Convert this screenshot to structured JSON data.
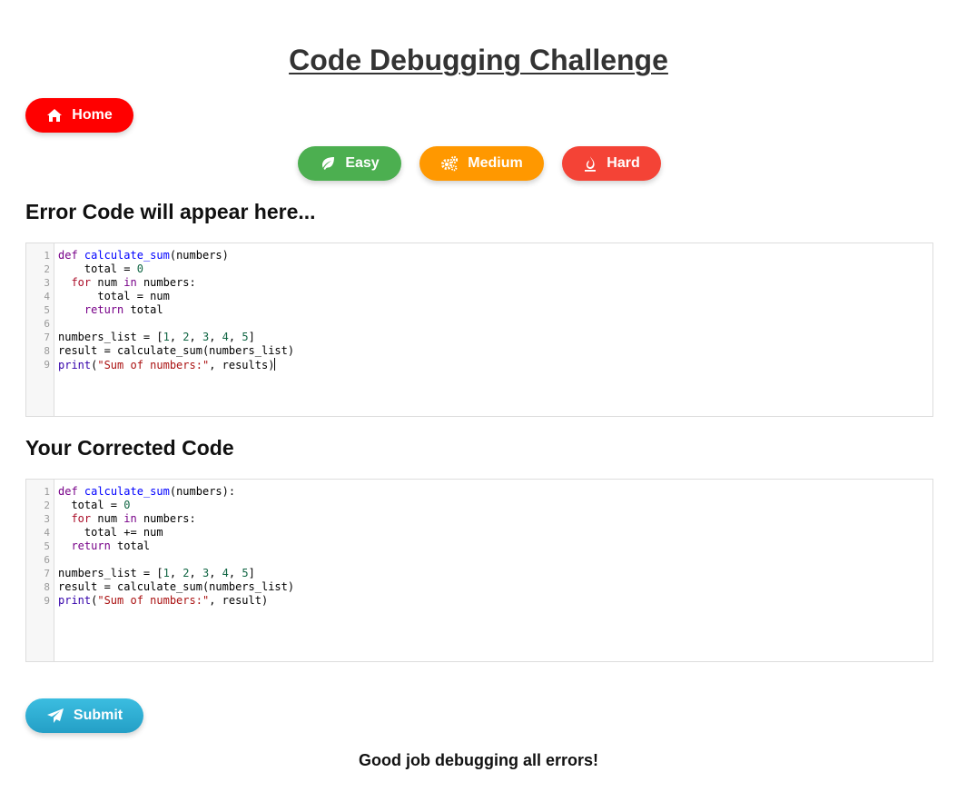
{
  "page": {
    "title": "Code Debugging Challenge"
  },
  "nav": {
    "home_label": "Home"
  },
  "difficulty": {
    "easy_label": "Easy",
    "medium_label": "Medium",
    "hard_label": "Hard"
  },
  "error_section": {
    "heading": "Error Code will appear here...",
    "line_numbers": [
      "1",
      "2",
      "3",
      "4",
      "5",
      "6",
      "7",
      "8",
      "9"
    ],
    "lines": [
      "def calculate_sum(numbers)",
      "    total = 0",
      "  for num in numbers:",
      "      total = num",
      "    return total",
      "",
      "numbers_list = [1, 2, 3, 4, 5]",
      "result = calculate_sum(numbers_list)",
      "print(\"Sum of numbers:\", results)"
    ]
  },
  "corrected_section": {
    "heading": "Your Corrected Code",
    "line_numbers": [
      "1",
      "2",
      "3",
      "4",
      "5",
      "6",
      "7",
      "8",
      "9"
    ],
    "lines": [
      "def calculate_sum(numbers):",
      "  total = 0",
      "  for num in numbers:",
      "    total += num",
      "  return total",
      "",
      "numbers_list = [1, 2, 3, 4, 5]",
      "result = calculate_sum(numbers_list)",
      "print(\"Sum of numbers:\", result)"
    ]
  },
  "actions": {
    "submit_label": "Submit"
  },
  "result": {
    "message": "Good job debugging all errors!"
  },
  "colors": {
    "home": "#ff0000",
    "easy": "#4caf50",
    "medium": "#ff9800",
    "hard": "#f44336",
    "submit": "#2aaad3"
  },
  "icons": {
    "home": "home-icon",
    "easy": "leaf-icon",
    "medium": "cogs-icon",
    "hard": "fire-icon",
    "submit": "paper-plane-icon"
  }
}
